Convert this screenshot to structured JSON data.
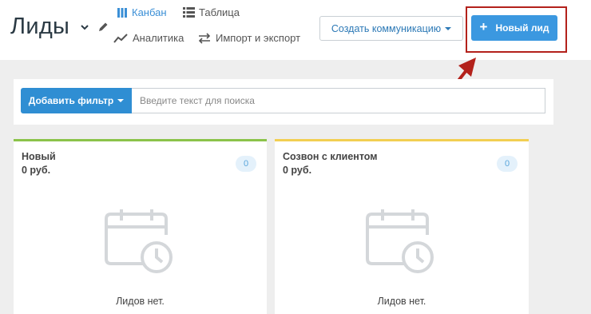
{
  "header": {
    "title": "Лиды",
    "views": [
      {
        "label": "Канбан",
        "icon": "kanban-icon",
        "active": true
      },
      {
        "label": "Таблица",
        "icon": "table-icon",
        "active": false
      },
      {
        "label": "Аналитика",
        "icon": "analytics-icon",
        "active": false
      },
      {
        "label": "Импорт и экспорт",
        "icon": "import-export-icon",
        "active": false
      }
    ],
    "create_communication_label": "Создать коммуникацию",
    "new_lead_label": "Новый лид"
  },
  "filter": {
    "add_filter_label": "Добавить фильтр",
    "search_placeholder": "Введите текст для поиска",
    "search_value": ""
  },
  "columns": [
    {
      "name": "Новый",
      "sum": "0  руб.",
      "count": "0",
      "empty_text": "Лидов нет.",
      "accent": "#8bc34a"
    },
    {
      "name": "Созвон с клиентом",
      "sum": "0  руб.",
      "count": "0",
      "empty_text": "Лидов нет.",
      "accent": "#f2cf52"
    }
  ],
  "colors": {
    "primary": "#3b98e0",
    "link": "#2c79b6",
    "highlight": "#b3211b"
  }
}
